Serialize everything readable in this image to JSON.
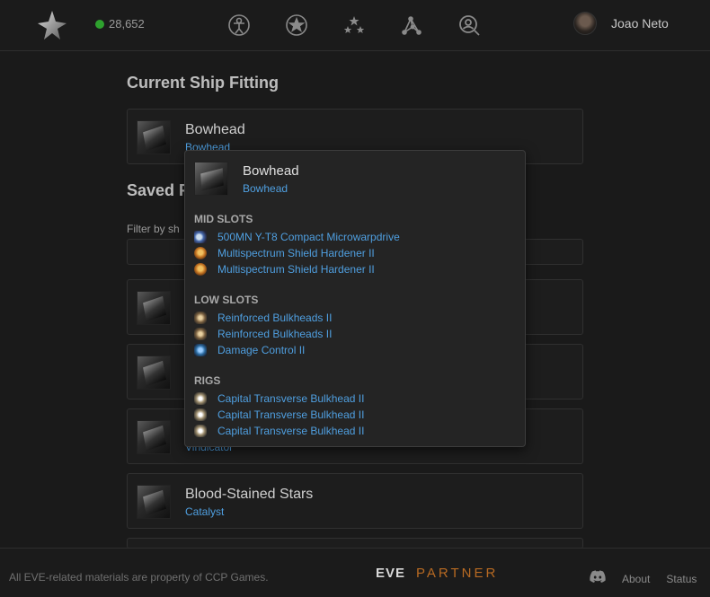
{
  "navbar": {
    "isk_balance": "28,652",
    "user_name": "Joao Neto",
    "icons": [
      "eve-logo-icon",
      "character-icon",
      "medal-icon",
      "stars-icon",
      "network-icon",
      "search-icon"
    ]
  },
  "main": {
    "current_section_title": "Current Ship Fitting",
    "current_fitting": {
      "name": "Bowhead",
      "type": "Bowhead"
    },
    "saved_section_title": "Saved F",
    "filter_label": "Filter by sh",
    "saved_fittings": [
      {
        "name": "",
        "type": ""
      },
      {
        "name": "",
        "type": ""
      },
      {
        "name": "",
        "type": "Vindicator"
      },
      {
        "name": "Blood-Stained Stars",
        "type": "Catalyst"
      }
    ]
  },
  "popup": {
    "title": "Bowhead",
    "subtitle": "Bowhead",
    "sections": [
      {
        "header": "MID SLOTS",
        "modules": [
          {
            "name": "500MN Y-T8 Compact Microwarpdrive",
            "icon": "microwarpdrive-icon"
          },
          {
            "name": "Multispectrum Shield Hardener II",
            "icon": "shield-hardener-icon"
          },
          {
            "name": "Multispectrum Shield Hardener II",
            "icon": "shield-hardener-icon"
          }
        ]
      },
      {
        "header": "LOW SLOTS",
        "modules": [
          {
            "name": "Reinforced Bulkheads II",
            "icon": "bulkhead-icon"
          },
          {
            "name": "Reinforced Bulkheads II",
            "icon": "bulkhead-icon"
          },
          {
            "name": "Damage Control II",
            "icon": "damage-control-icon"
          }
        ]
      },
      {
        "header": "RIGS",
        "modules": [
          {
            "name": "Capital Transverse Bulkhead II",
            "icon": "rig-icon"
          },
          {
            "name": "Capital Transverse Bulkhead II",
            "icon": "rig-icon"
          },
          {
            "name": "Capital Transverse Bulkhead II",
            "icon": "rig-icon"
          }
        ]
      }
    ]
  },
  "footer": {
    "copyright": "All EVE-related materials are property of CCP Games.",
    "eve_logo_text": "EVE",
    "partner_text": "PARTNER",
    "links": {
      "about": "About",
      "status": "Status"
    }
  },
  "colors": {
    "link": "#4f9fe0",
    "isk_indicator": "#2ea12e",
    "partner": "#b86a22",
    "background": "#1a1a1a"
  }
}
